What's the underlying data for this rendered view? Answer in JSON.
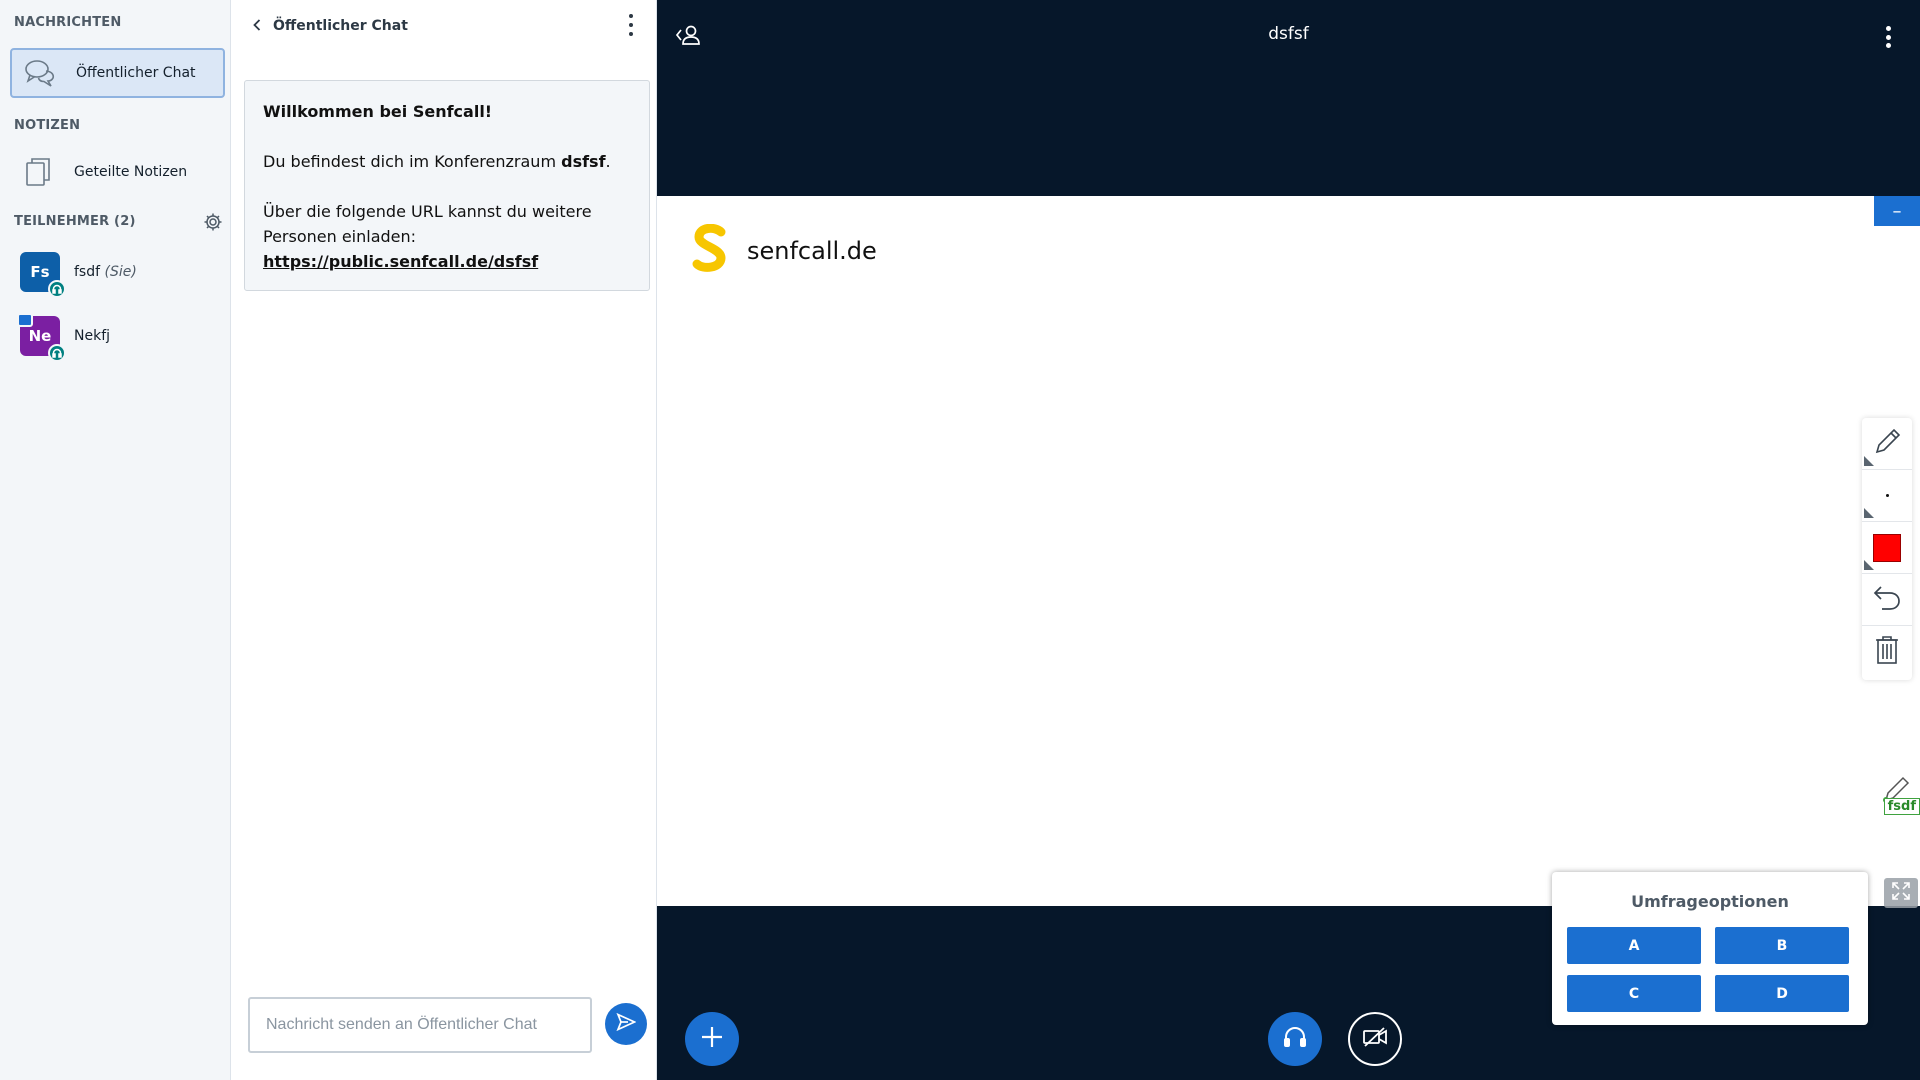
{
  "sidebar": {
    "messages_title": "NACHRICHTEN",
    "public_chat_label": "Öffentlicher Chat",
    "notes_title": "NOTIZEN",
    "shared_notes_label": "Geteilte Notizen",
    "participants_title": "TEILNEHMER (2)",
    "users": [
      {
        "initials": "Fs",
        "name": "fsdf",
        "suffix": "(Sie)",
        "color": "#0d5fa8"
      },
      {
        "initials": "Ne",
        "name": "Nekfj",
        "suffix": "",
        "color": "#7b1fa2"
      }
    ]
  },
  "chat": {
    "header_title": "Öffentlicher Chat",
    "welcome_heading": "Willkommen bei Senfcall!",
    "room_line_prefix": "Du befindest dich im Konferenzraum ",
    "room_name": "dsfsf",
    "room_line_suffix": ".",
    "invite_text": "Über die folgende URL kannst du weitere Personen einladen:",
    "invite_url": "https://public.senfcall.de/dsfsf",
    "input_placeholder": "Nachricht senden an Öffentlicher Chat"
  },
  "main": {
    "room_title": "dsfsf",
    "logo_text": "senfcall.de",
    "cursor_label": "fsdf",
    "minimize_label": "–"
  },
  "poll": {
    "title": "Umfrageoptionen",
    "options": [
      "A",
      "B",
      "C",
      "D"
    ]
  },
  "colors": {
    "accent": "#1b6fd0",
    "dark_bg": "#06172a",
    "logo_yellow": "#f7c600",
    "pen_color": "#ff0000"
  }
}
